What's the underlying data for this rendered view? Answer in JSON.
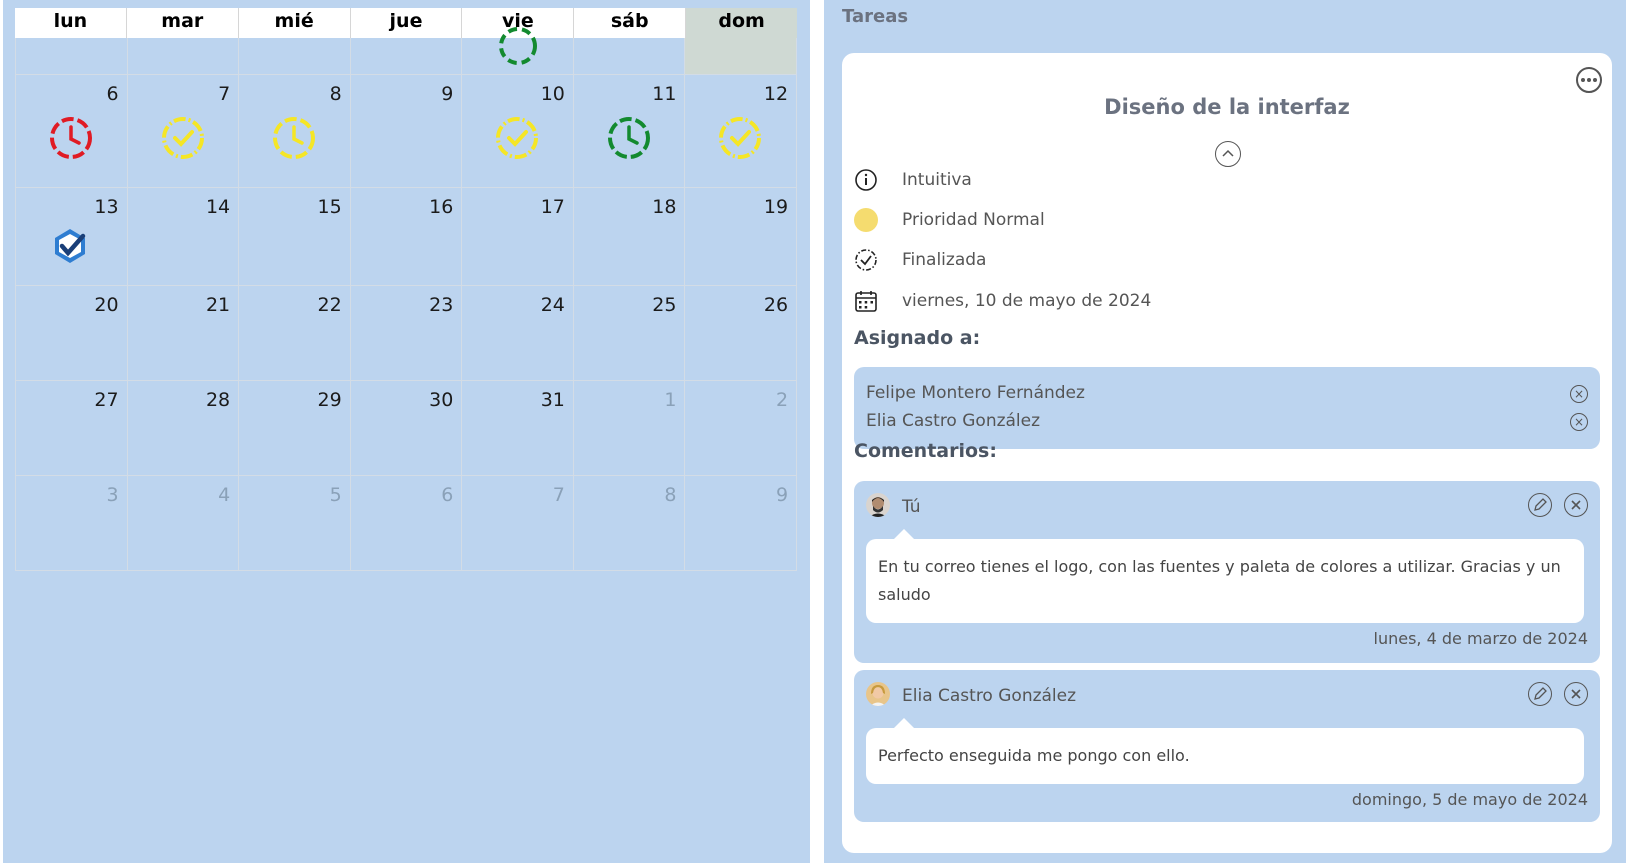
{
  "calendar": {
    "weekdays": [
      "lun",
      "mar",
      "mié",
      "jue",
      "vie",
      "sáb",
      "dom"
    ],
    "rows": [
      {
        "days": [
          "",
          "",
          "",
          "",
          "",
          "",
          ""
        ]
      },
      {
        "days": [
          "6",
          "7",
          "8",
          "9",
          "10",
          "11",
          "12"
        ]
      },
      {
        "days": [
          "13",
          "14",
          "15",
          "16",
          "17",
          "18",
          "19"
        ]
      },
      {
        "days": [
          "20",
          "21",
          "22",
          "23",
          "24",
          "25",
          "26"
        ]
      },
      {
        "days": [
          "27",
          "28",
          "29",
          "30",
          "31",
          "1",
          "2"
        ]
      },
      {
        "days": [
          "3",
          "4",
          "5",
          "6",
          "7",
          "8",
          "9"
        ]
      }
    ]
  },
  "colors": {
    "red": "#e01b24",
    "yellow": "#f5e626",
    "green": "#138a2f",
    "blue": "#1f5faa",
    "bg": "#bcd4ef"
  },
  "panel": {
    "header": "Tareas",
    "task": {
      "title": "Diseño de la interfaz",
      "description": "Intuitiva",
      "priority": "Prioridad Normal",
      "status": "Finalizada",
      "date": "viernes, 10 de mayo de 2024"
    },
    "assigned_label": "Asignado a:",
    "assignees": [
      "Felipe Montero Fernández",
      "Elia Castro González"
    ],
    "comments_label": "Comentarios:",
    "comments": [
      {
        "author": "Tú",
        "text": "En tu correo tienes el logo, con las fuentes y paleta de colores a utilizar. Gracias y un saludo",
        "date": "lunes, 4 de marzo de 2024"
      },
      {
        "author": "Elia Castro González",
        "text": "Perfecto enseguida me pongo con ello.",
        "date": "domingo, 5 de mayo de 2024"
      }
    ]
  }
}
